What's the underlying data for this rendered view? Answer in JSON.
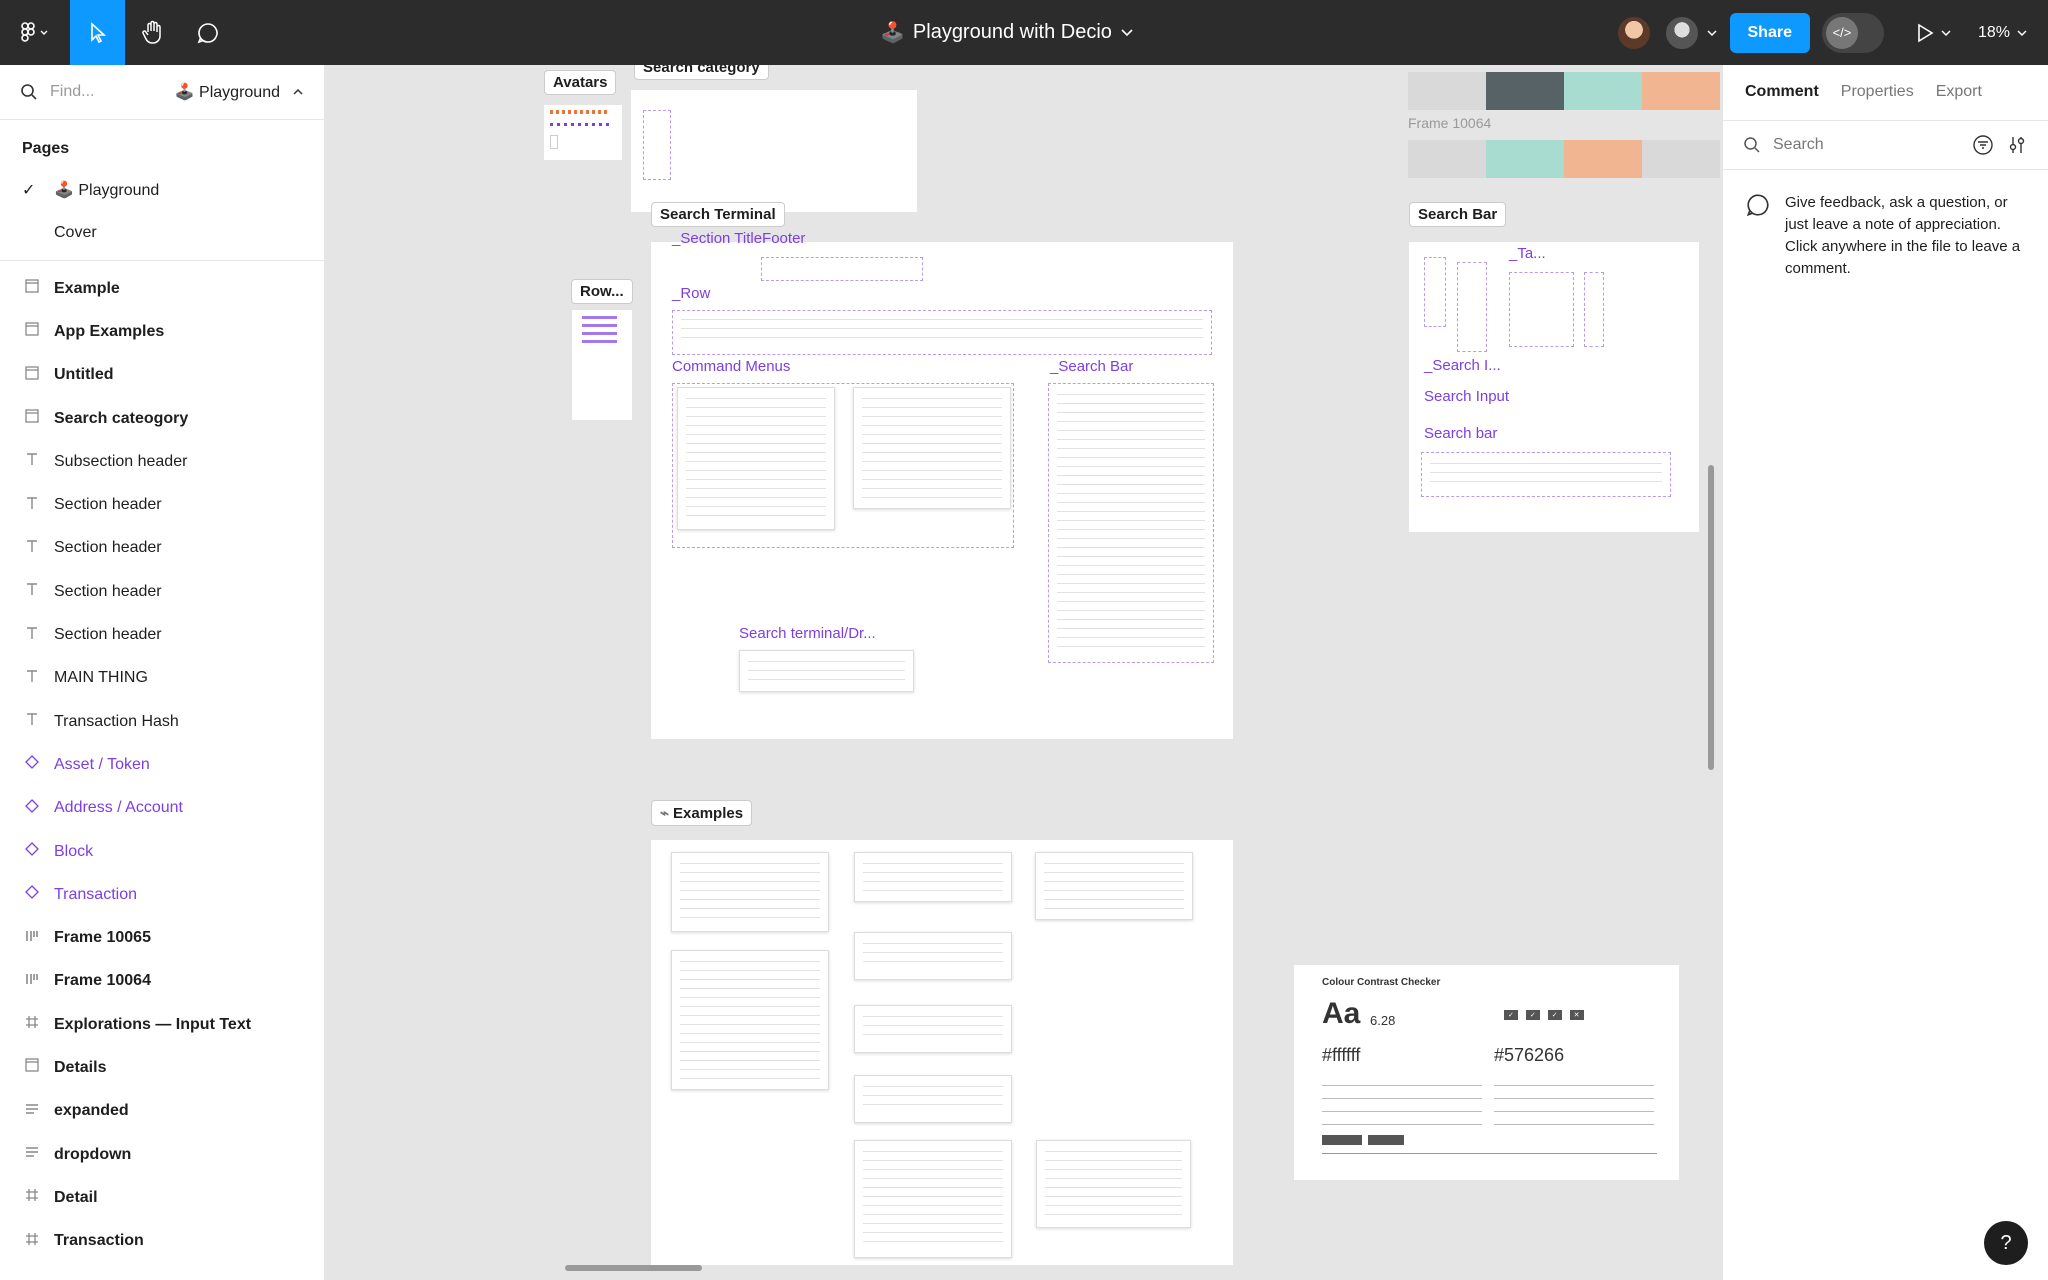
{
  "topbar": {
    "file_icon": "🕹️",
    "file_title": "Playground with Decio",
    "share_label": "Share",
    "zoom": "18%"
  },
  "left_panel": {
    "search_placeholder": "Find...",
    "current_page": "🕹️ Playground",
    "pages_header": "Pages",
    "pages": [
      {
        "label": "🕹️ Playground",
        "selected": true
      },
      {
        "label": "Cover",
        "selected": false
      }
    ],
    "layers": [
      {
        "label": "Example",
        "icon": "frame-icon"
      },
      {
        "label": "App Examples",
        "icon": "frame-icon"
      },
      {
        "label": "Untitled",
        "icon": "frame-icon"
      },
      {
        "label": "Search cateogory",
        "icon": "frame-icon"
      },
      {
        "label": "Subsection header",
        "icon": "text-icon"
      },
      {
        "label": "Section header",
        "icon": "text-icon"
      },
      {
        "label": "Section header",
        "icon": "text-icon"
      },
      {
        "label": "Section header",
        "icon": "text-icon"
      },
      {
        "label": "Section header",
        "icon": "text-icon"
      },
      {
        "label": "MAIN THING",
        "icon": "text-icon"
      },
      {
        "label": "Transaction Hash",
        "icon": "text-icon"
      },
      {
        "label": "Asset / Token",
        "icon": "component-icon"
      },
      {
        "label": "Address / Account",
        "icon": "component-icon"
      },
      {
        "label": "Block",
        "icon": "component-icon"
      },
      {
        "label": "Transaction",
        "icon": "component-icon"
      },
      {
        "label": "Frame 10065",
        "icon": "autolayout-icon"
      },
      {
        "label": "Frame 10064",
        "icon": "autolayout-icon"
      },
      {
        "label": "Explorations — Input Text",
        "icon": "grid-icon"
      },
      {
        "label": "Details",
        "icon": "frame-icon"
      },
      {
        "label": "expanded",
        "icon": "stack-icon"
      },
      {
        "label": "dropdown",
        "icon": "stack-icon"
      },
      {
        "label": "Detail",
        "icon": "grid-icon"
      },
      {
        "label": "Transaction",
        "icon": "grid-icon"
      }
    ]
  },
  "right_panel": {
    "tabs": [
      "Comment",
      "Properties",
      "Export"
    ],
    "active_tab": "Comment",
    "search_placeholder": "Search",
    "tip": "Give feedback, ask a question, or just leave a note of appreciation. Click anywhere in the file to leave a comment."
  },
  "canvas": {
    "tags": {
      "avatars": "Avatars",
      "search_category": "Search category",
      "search_terminal": "Search Terminal",
      "row": "Row...",
      "search_bar": "Search Bar",
      "examples": "Examples",
      "frame_10064": "Frame 10064"
    },
    "components": {
      "section_title_footer": "_Section TitleFooter",
      "row": "_Row",
      "command_menus": "Command Menus",
      "search_bar_comp": "_Search Bar",
      "search_terminal_dr": "Search terminal/Dr...",
      "ta": "_Ta...",
      "search_i": "_Search I...",
      "search_input": "Search Input",
      "search_bar_lower": "Search bar"
    },
    "swatch_colors": [
      "#d9d9d9",
      "#576266",
      "#a8dcd1",
      "#f2b591"
    ],
    "contrast_checker": {
      "title": "Colour Contrast Checker",
      "aa": "Aa",
      "ratio": "6.28",
      "fg_hex": "#ffffff",
      "bg_hex": "#576266"
    }
  }
}
